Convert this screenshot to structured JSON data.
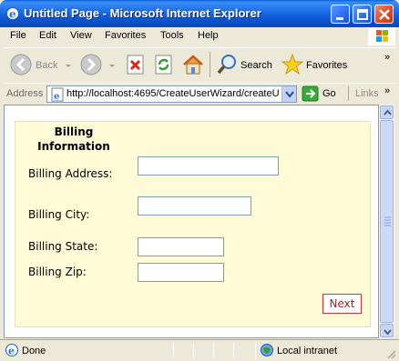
{
  "window": {
    "title": "Untitled Page - Microsoft Internet Explorer"
  },
  "menu": {
    "items": [
      "File",
      "Edit",
      "View",
      "Favorites",
      "Tools",
      "Help"
    ]
  },
  "toolbar": {
    "back_label": "Back",
    "search_label": "Search",
    "favorites_label": "Favorites"
  },
  "address": {
    "label": "Address",
    "url": "http://localhost:4695/CreateUserWizard/createU",
    "go_label": "Go",
    "links_label": "Links"
  },
  "wizard": {
    "title_line1": "Billing",
    "title_line2": "Information",
    "fields": [
      {
        "label": "Billing Address:",
        "value": ""
      },
      {
        "label": "Billing City:",
        "value": ""
      },
      {
        "label": "Billing State:",
        "value": ""
      },
      {
        "label": "Billing Zip:",
        "value": ""
      }
    ],
    "next_label": "Next"
  },
  "status": {
    "text": "Done",
    "zone": "Local intranet"
  },
  "colors": {
    "wizard_background": "#fffbd6",
    "next_border": "#cc3333"
  }
}
